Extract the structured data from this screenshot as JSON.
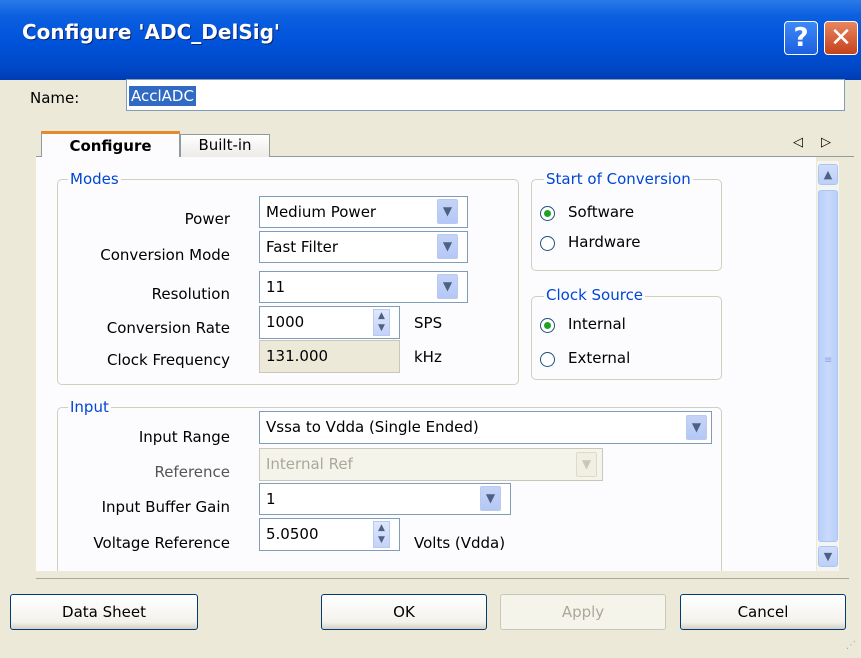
{
  "window": {
    "title": "Configure 'ADC_DelSig'",
    "help_glyph": "?",
    "close_glyph": "✕"
  },
  "name_row": {
    "label": "Name:",
    "value": "AcclADC"
  },
  "tabs": [
    {
      "label": "Configure",
      "active": true
    },
    {
      "label": "Built-in",
      "active": false
    }
  ],
  "tab_nav": {
    "prev_glyph": "◁",
    "next_glyph": "▷"
  },
  "modes": {
    "title": "Modes",
    "power": {
      "label": "Power",
      "value": "Medium Power"
    },
    "conversion_mode": {
      "label": "Conversion Mode",
      "value": "Fast Filter"
    },
    "resolution": {
      "label": "Resolution",
      "value": "11"
    },
    "conversion_rate": {
      "label": "Conversion Rate",
      "value": "1000",
      "unit": "SPS"
    },
    "clock_frequency": {
      "label": "Clock Frequency",
      "value": "131.000",
      "unit": "kHz"
    }
  },
  "start_of_conversion": {
    "title": "Start of Conversion",
    "options": [
      {
        "label": "Software",
        "selected": true
      },
      {
        "label": "Hardware",
        "selected": false
      }
    ]
  },
  "clock_source": {
    "title": "Clock Source",
    "options": [
      {
        "label": "Internal",
        "selected": true
      },
      {
        "label": "External",
        "selected": false
      }
    ]
  },
  "input": {
    "title": "Input",
    "input_range": {
      "label": "Input Range",
      "value": "Vssa to Vdda (Single Ended)"
    },
    "reference": {
      "label": "Reference",
      "value": "Internal Ref",
      "disabled": true
    },
    "input_buffer_gain": {
      "label": "Input Buffer Gain",
      "value": "1"
    },
    "voltage_reference": {
      "label": "Voltage Reference",
      "value": "5.0500",
      "unit": "Volts (Vdda)"
    }
  },
  "buttons": {
    "datasheet": "Data Sheet",
    "ok": "OK",
    "apply": "Apply",
    "cancel": "Cancel"
  },
  "colors": {
    "titlebar": "#0052d9",
    "group_title": "#0046d5",
    "tab_highlight": "#e68b2c",
    "selection": "#316ac5"
  }
}
